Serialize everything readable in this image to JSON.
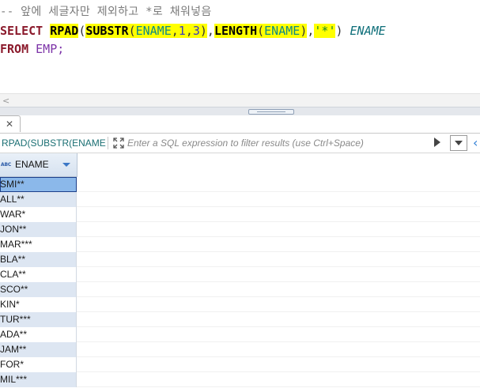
{
  "editor": {
    "comment": "-- 앞에 세글자만 제외하고 *로 채워넣음",
    "sql_tokens": {
      "select": "SELECT",
      "rpad": "RPAD",
      "p_open1": "(",
      "substr": "SUBSTR",
      "p_open2": "(",
      "col1": "ENAME",
      "comma1": ",",
      "n1": "1",
      "comma2": ",",
      "n2": "3",
      "p_close1": ")",
      "comma3": ",",
      "length": "LENGTH",
      "p_open3": "(",
      "col2": "ENAME",
      "p_close2": ")",
      "comma4": ",",
      "q_open": "'",
      "star": "*",
      "q_close": "'",
      "p_close3": ")",
      "alias": "ENAME",
      "from": "FROM",
      "table": "EMP",
      "semicolon": ";"
    },
    "highlight_color": "#ffff00"
  },
  "scroll": {
    "left_arrow": "<"
  },
  "result_tab": {
    "close_glyph": "✕"
  },
  "filter_bar": {
    "query_name": "RPAD(SUBSTR(ENAME,1",
    "placeholder": "Enter a SQL expression to filter results (use Ctrl+Space)",
    "expand_icon": "expand-icon",
    "edge_arrow": "‹"
  },
  "grid": {
    "type_icon_text": "ABC",
    "column_header": "ENAME",
    "selected_row_index": 0,
    "rows": [
      "SMI**",
      "ALL**",
      "WAR*",
      "JON**",
      "MAR***",
      "BLA**",
      "CLA**",
      "SCO**",
      "KIN*",
      "TUR***",
      "ADA**",
      "JAM**",
      "FOR*",
      "MIL***"
    ],
    "colors": {
      "row_even": "#dde6f2",
      "row_selected": "#8bb8ea",
      "accent": "#3b77c6"
    }
  }
}
